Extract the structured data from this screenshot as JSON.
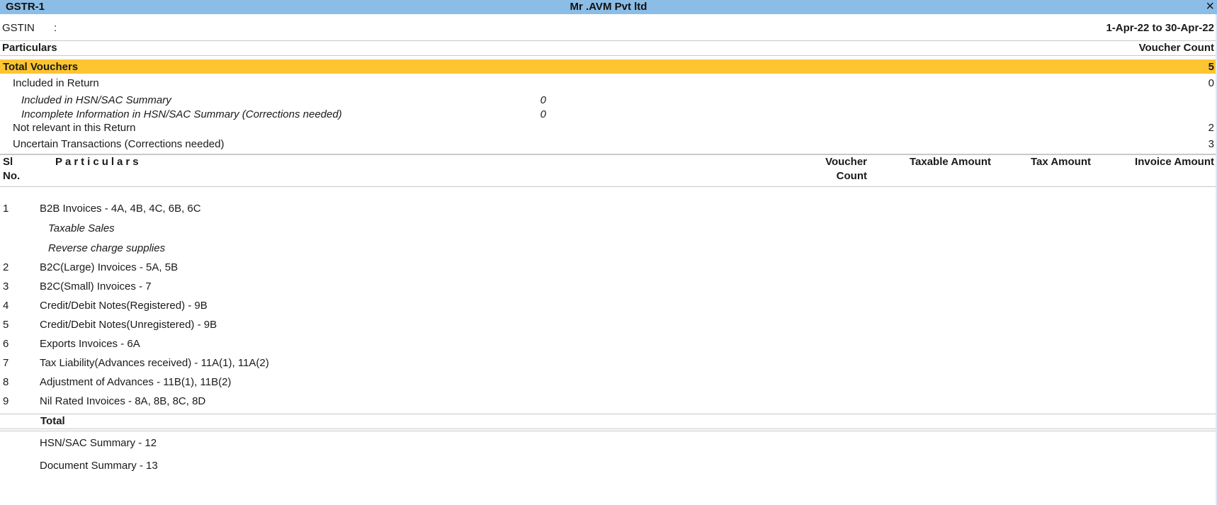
{
  "window": {
    "report_name": "GSTR-1",
    "company_name": "Mr .AVM  Pvt ltd",
    "close_icon": "×"
  },
  "info": {
    "gstin_label": "GSTIN",
    "gstin_separator": ":",
    "gstin_value": "",
    "period": "1-Apr-22 to 30-Apr-22"
  },
  "summary": {
    "header_particulars": "Particulars",
    "header_voucher_count": "Voucher Count",
    "total_vouchers": {
      "label": "Total Vouchers",
      "count": "5"
    },
    "included_in_return": {
      "label": "Included in Return",
      "count": "0"
    },
    "included_hsn": {
      "label": "Included in HSN/SAC Summary",
      "count": "0"
    },
    "incomplete_hsn": {
      "label": "Incomplete Information in HSN/SAC Summary (Corrections needed)",
      "count": "0"
    },
    "not_relevant": {
      "label": "Not relevant in this Return",
      "count": "2"
    },
    "uncertain": {
      "label": "Uncertain Transactions (Corrections needed)",
      "count": "3"
    }
  },
  "table": {
    "headers": {
      "sl_line1": "Sl",
      "sl_line2": "No.",
      "particulars": "Particulars",
      "voucher_count_line1": "Voucher",
      "voucher_count_line2": "Count",
      "taxable_amount": "Taxable Amount",
      "tax_amount": "Tax Amount",
      "invoice_amount": "Invoice Amount"
    },
    "rows": [
      {
        "sl": "1",
        "label": "B2B Invoices - 4A, 4B, 4C, 6B, 6C"
      },
      {
        "sl": "",
        "label": "Taxable Sales"
      },
      {
        "sl": "",
        "label": "Reverse charge supplies"
      },
      {
        "sl": "2",
        "label": "B2C(Large) Invoices - 5A, 5B"
      },
      {
        "sl": "3",
        "label": "B2C(Small) Invoices - 7"
      },
      {
        "sl": "4",
        "label": "Credit/Debit Notes(Registered) - 9B"
      },
      {
        "sl": "5",
        "label": "Credit/Debit Notes(Unregistered) - 9B"
      },
      {
        "sl": "6",
        "label": "Exports Invoices - 6A"
      },
      {
        "sl": "7",
        "label": "Tax Liability(Advances received) - 11A(1), 11A(2)"
      },
      {
        "sl": "8",
        "label": "Adjustment of Advances - 11B(1), 11B(2)"
      },
      {
        "sl": "9",
        "label": "Nil Rated Invoices - 8A, 8B, 8C, 8D"
      }
    ],
    "total_label": "Total",
    "extra": [
      {
        "label": "HSN/SAC Summary - 12"
      },
      {
        "label": "Document Summary - 13"
      }
    ]
  }
}
